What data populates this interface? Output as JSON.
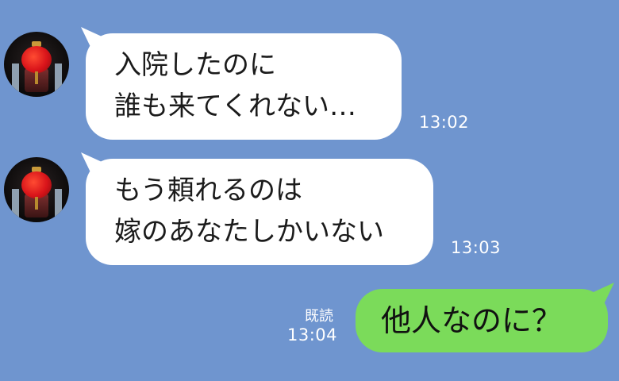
{
  "chat": {
    "background_color": "#6f95cf",
    "messages": [
      {
        "sender": "other",
        "avatar_icon": "red-lantern-avatar",
        "lines": [
          "入院したのに",
          "誰も来てくれない…"
        ],
        "time": "13:02"
      },
      {
        "sender": "other",
        "avatar_icon": "red-lantern-avatar",
        "lines": [
          "もう頼れるのは",
          "嫁のあなたしかいない"
        ],
        "time": "13:03"
      },
      {
        "sender": "me",
        "text": "他人なのに？",
        "read_label": "既読",
        "time": "13:04",
        "bubble_color": "#7bdb5a"
      }
    ]
  }
}
